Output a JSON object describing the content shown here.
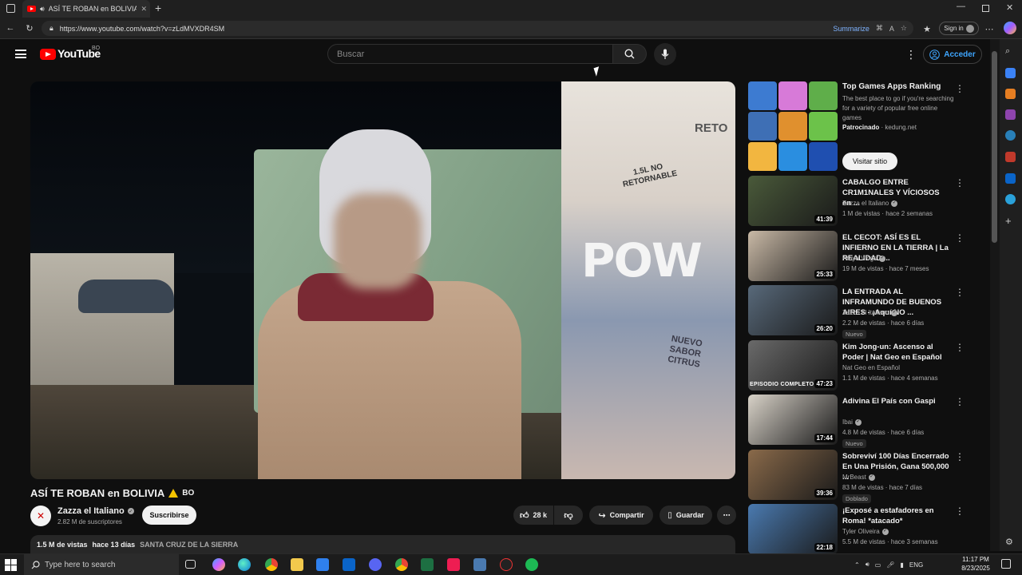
{
  "browser": {
    "tab_title": "ASÍ TE ROBAN en BOLIVIA ⚠️",
    "url": "https://www.youtube.com/watch?v=zLdMVXDR4SM",
    "summarize_label": "Summarize",
    "signin_label": "Sign in"
  },
  "header": {
    "logo_text": "YouTube",
    "region": "BO",
    "search_placeholder": "Buscar",
    "signin_label": "Acceder"
  },
  "video": {
    "title": "ASÍ TE ROBAN en BOLIVIA",
    "title_suffix": "BO",
    "frame_text": {
      "pow": "POW",
      "bottle": "1.5L NO RETORNABLE",
      "nuevo": "NUEVO SABOR CITRUS",
      "reto": "RETO"
    },
    "channel": "Zazza el Italiano",
    "subscribers": "2.82 M de suscriptores",
    "subscribe_label": "Suscribirse",
    "likes": "28 k",
    "share_label": "Compartir",
    "save_label": "Guardar",
    "views": "1.5 M de vistas",
    "age": "hace 13 días",
    "location": "SANTA CRUZ DE LA SIERRA"
  },
  "ad": {
    "title": "Top Games Apps Ranking",
    "body": "The best place to go if you're searching for a variety of popular free online games",
    "sponsored": "Patrocinado",
    "domain": "kedung.net",
    "cta": "Visitar sitio",
    "tile_colors": [
      "#3d7bd1",
      "#d77ad8",
      "#5fae4a",
      "#3e6fb5",
      "#e0902e",
      "#6cc24a",
      "#f2b640",
      "#2a8ee0",
      "#1f4fb0"
    ]
  },
  "recommendations": [
    {
      "title": "CABALGO ENTRE CR1M1NALES Y VÍCIOSOS en ...",
      "channel": "Zazza el Italiano",
      "verified": true,
      "meta": "1 M de vistas · hace 2 semanas",
      "duration": "41:39",
      "badge": "",
      "color": "#4a5a3a"
    },
    {
      "title": "EL CECOT: ASÍ ES EL INFIERNO EN LA TIERRA | La REALIDAD ...",
      "channel": "Araya Vlogs",
      "verified": true,
      "meta": "19 M de vistas · hace 7 meses",
      "duration": "25:33",
      "badge": "",
      "color": "#c9b9a6"
    },
    {
      "title": "LA ENTRADA AL INFRAMUNDO DE BUENOS AIRES - ¡Aquí NO ...",
      "channel": "Zazza el Italiano",
      "verified": true,
      "meta": "2.2 M de vistas · hace 6 días",
      "duration": "26:20",
      "badge": "Nuevo",
      "color": "#58697a"
    },
    {
      "title": "Kim Jong-un: Ascenso al Poder | Nat Geo en Español",
      "channel": "Nat Geo en Español",
      "verified": false,
      "meta": "1.1 M de vistas · hace 4 semanas",
      "duration": "47:23",
      "badge": "",
      "color": "#6a6a6a",
      "overlay": "EPISODIO COMPLETO"
    },
    {
      "title": "Adivina El País con Gaspi",
      "channel": "Ibai",
      "verified": true,
      "meta": "4.8 M de vistas · hace 6 días",
      "duration": "17:44",
      "badge": "Nuevo",
      "color": "#d8d2c8"
    },
    {
      "title": "Sobreviví 100 Días Encerrado En Una Prisión, Gana 500,000 ...",
      "channel": "MrBeast",
      "verified": true,
      "meta": "83 M de vistas · hace 7 días",
      "duration": "39:36",
      "badge": "Doblado",
      "color": "#8a6a4a"
    },
    {
      "title": "¡Exposé a estafadores en Roma! *atacado*",
      "channel": "Tyler Oliveira",
      "verified": true,
      "meta": "5.5 M de vistas · hace 3 semanas",
      "duration": "22:18",
      "badge": "",
      "color": "#4a7ab0"
    }
  ],
  "taskbar": {
    "search_placeholder": "Type here to search",
    "lang": "ENG",
    "time": "11:17 PM",
    "date": "8/23/2025"
  }
}
